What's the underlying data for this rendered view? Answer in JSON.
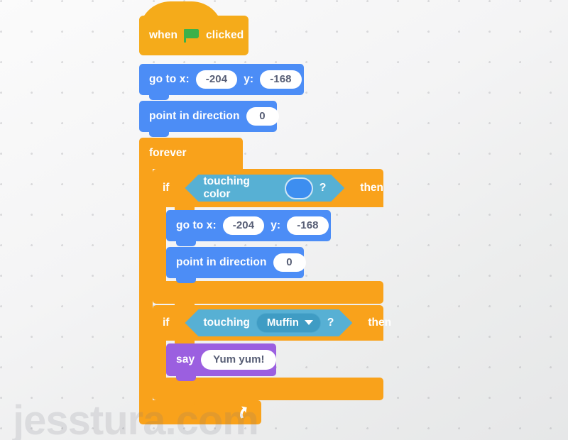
{
  "watermark": {
    "text": "jesstura.com"
  },
  "canvas": {
    "background_color": "#f2f3f4",
    "dot_color": "#9a9aa0"
  },
  "palette": {
    "events": "#f5ab1a",
    "motion": "#4c8df6",
    "control": "#f9a21b",
    "sensing": "#57b0d4",
    "looks": "#9b5fe0",
    "input_fill": "#ffffff",
    "input_text": "#575e75",
    "color_swatch": "#3d8ef0",
    "flag_green": "#3cb14a"
  },
  "script": {
    "hat": {
      "prefix": "when",
      "icon": "green-flag-icon",
      "suffix": "clicked"
    },
    "goto_top": {
      "label_x": "go to x:",
      "value_x": "-204",
      "label_y": "y:",
      "value_y": "-168"
    },
    "point_top": {
      "label": "point in direction",
      "value": "0"
    },
    "forever": {
      "label": "forever",
      "loop_icon": "loop-arrow-icon"
    },
    "if_color": {
      "if_label": "if",
      "then_label": "then",
      "condition_label": "touching color",
      "condition_swatch": "#3d8ef0",
      "question_mark": "?",
      "body": {
        "goto": {
          "label_x": "go to x:",
          "value_x": "-204",
          "label_y": "y:",
          "value_y": "-168"
        },
        "point": {
          "label": "point in direction",
          "value": "0"
        }
      }
    },
    "if_muffin": {
      "if_label": "if",
      "then_label": "then",
      "condition_label": "touching",
      "dropdown_value": "Muffin",
      "dropdown_icon": "chevron-down-icon",
      "question_mark": "?",
      "body": {
        "say": {
          "label": "say",
          "message": "Yum yum!"
        }
      }
    }
  }
}
